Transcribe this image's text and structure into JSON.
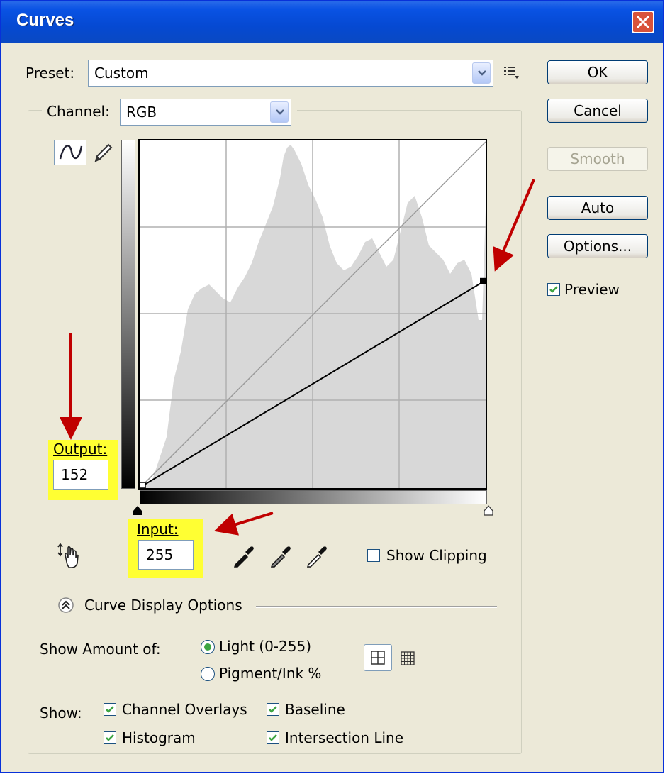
{
  "window": {
    "title": "Curves"
  },
  "preset": {
    "label": "Preset:",
    "value": "Custom"
  },
  "channel": {
    "label": "Channel:",
    "value": "RGB"
  },
  "buttons": {
    "ok": "OK",
    "cancel": "Cancel",
    "smooth": "Smooth",
    "auto": "Auto",
    "options": "Options..."
  },
  "preview": {
    "label": "Preview",
    "checked": true
  },
  "output": {
    "label": "Output:",
    "value": "152"
  },
  "input": {
    "label": "Input:",
    "value": "255"
  },
  "show_clipping": {
    "label": "Show Clipping",
    "checked": false
  },
  "curve_display_options": {
    "label": "Curve Display Options"
  },
  "show_amount": {
    "label": "Show Amount of:",
    "options": [
      "Light  (0-255)",
      "Pigment/Ink %"
    ],
    "selected": "Light  (0-255)"
  },
  "show": {
    "label": "Show:",
    "items": [
      {
        "label": "Channel Overlays",
        "checked": true
      },
      {
        "label": "Baseline",
        "checked": true
      },
      {
        "label": "Histogram",
        "checked": true
      },
      {
        "label": "Intersection Line",
        "checked": true
      }
    ]
  },
  "curve": {
    "points": [
      [
        0,
        0
      ],
      [
        255,
        152
      ]
    ]
  },
  "colors": {
    "title_bar": "#0A53E4",
    "highlight": "#FFFF33",
    "arrow": "#C00000",
    "check": "#3DA542",
    "dialog_bg": "#ECE9D8"
  }
}
